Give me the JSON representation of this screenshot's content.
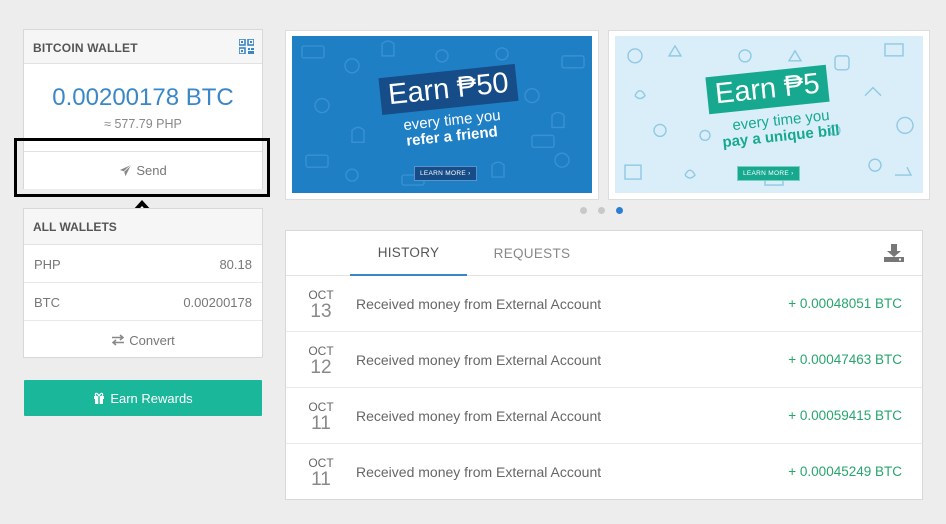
{
  "wallet": {
    "title": "BITCOIN WALLET",
    "qr_icon": "qr-code-icon",
    "balance": "0.00200178 BTC",
    "php_equiv": "≈ 577.79 PHP",
    "send_label": "Send",
    "send_icon": "paper-plane-icon"
  },
  "all_wallets": {
    "title": "ALL WALLETS",
    "rows": [
      {
        "currency": "PHP",
        "value": "80.18"
      },
      {
        "currency": "BTC",
        "value": "0.00200178"
      }
    ],
    "convert_label": "Convert",
    "convert_icon": "exchange-arrows-icon"
  },
  "earn_rewards": {
    "label": "Earn Rewards",
    "icon": "gift-icon",
    "color": "#1bb79a"
  },
  "banners": [
    {
      "headline": "Earn ₱50",
      "line1": "every time you",
      "line2": "refer a friend",
      "cta": "LEARN MORE ›",
      "color": "#1f7fc5"
    },
    {
      "headline": "Earn ₱5",
      "line1": "every time you",
      "line2": "pay a unique bill",
      "cta": "LEARN MORE ›",
      "color": "#d9eef9"
    }
  ],
  "carousel": {
    "dot_count": 3,
    "active_index": 2
  },
  "history": {
    "tabs": [
      {
        "label": "HISTORY",
        "active": true
      },
      {
        "label": "REQUESTS",
        "active": false
      }
    ],
    "download_icon": "download-icon",
    "rows": [
      {
        "month": "OCT",
        "day": "13",
        "description": "Received money from External Account",
        "amount": "+ 0.00048051 BTC"
      },
      {
        "month": "OCT",
        "day": "12",
        "description": "Received money from External Account",
        "amount": "+ 0.00047463 BTC"
      },
      {
        "month": "OCT",
        "day": "11",
        "description": "Received money from External Account",
        "amount": "+ 0.00059415 BTC"
      },
      {
        "month": "OCT",
        "day": "11",
        "description": "Received money from External Account",
        "amount": "+ 0.00045249 BTC"
      }
    ]
  },
  "colors": {
    "accent_blue": "#3a87c8",
    "positive_green": "#27a56d",
    "page_bg": "#ededed"
  }
}
